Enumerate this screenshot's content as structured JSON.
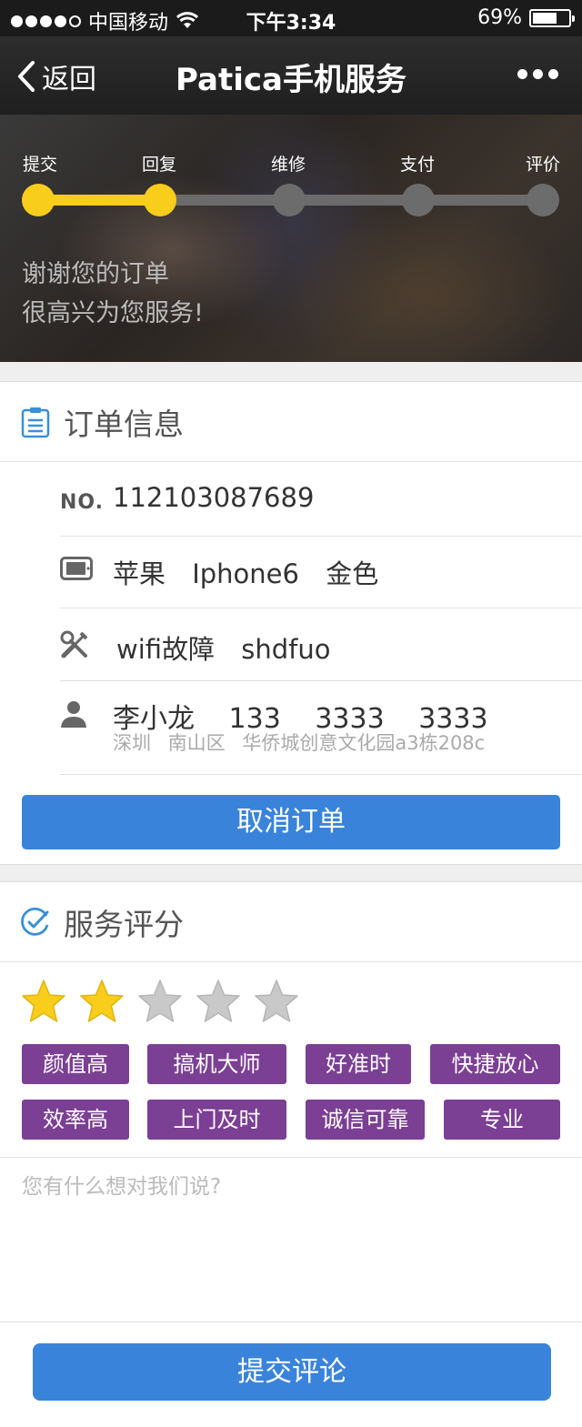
{
  "status_bar": {
    "carrier": "中国移动",
    "time": "下午3:34",
    "battery_text": "69%",
    "battery_level": 0.69,
    "signal_bars": 4
  },
  "nav": {
    "back_label": "返回",
    "title": "Patica手机服务"
  },
  "progress": {
    "steps": [
      "提交",
      "回复",
      "维修",
      "支付",
      "评价"
    ],
    "completed_steps": 2,
    "accent_color": "#f8cd1b"
  },
  "hero": {
    "line1": "谢谢您的订单",
    "line2": "很高兴为您服务!"
  },
  "order": {
    "section_title": "订单信息",
    "no_label": "NO.",
    "no_value": "112103087689",
    "device": "苹果 Iphone6 金色",
    "fault": "wifi故障 shdfuo",
    "contact": "李小龙 133 3333 3333",
    "address": "深圳 南山区 华侨城创意文化园a3栋208c",
    "cancel_label": "取消订单"
  },
  "rating": {
    "section_title": "服务评分",
    "stars_filled": 2,
    "stars_total": 5,
    "tags": [
      "颜值高",
      "搞机大师",
      "好准时",
      "快捷放心",
      "效率高",
      "上门及时",
      "诚信可靠",
      "专业"
    ],
    "tag_color": "#7b3f94",
    "comment_placeholder": "您有什么想对我们说?",
    "submit_label": "提交评论",
    "button_color": "#3a83da"
  }
}
